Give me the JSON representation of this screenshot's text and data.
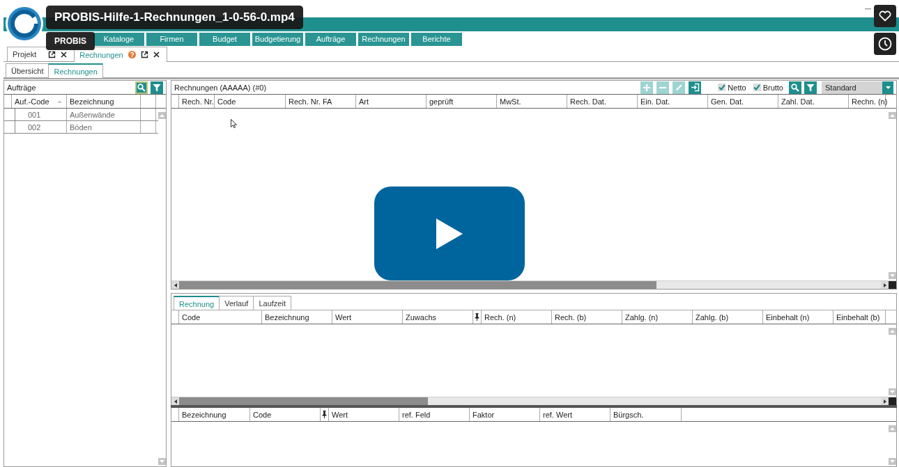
{
  "video": {
    "title": "PROBIS-Hilfe-1-Rechnungen_1-0-56-0.mp4",
    "channel": "PROBIS"
  },
  "app": {
    "nav": [
      "Kataloge",
      "Firmen",
      "Budget",
      "Budgetierung",
      "Aufträge",
      "Rechnungen",
      "Berichte"
    ],
    "doc_tabs": [
      {
        "label": "Projekt",
        "selected": false,
        "help": false
      },
      {
        "label": "Rechnungen",
        "selected": true,
        "help": true
      }
    ],
    "sub_tabs": [
      {
        "label": "Übersicht",
        "selected": false
      },
      {
        "label": "Rechnungen",
        "selected": true
      }
    ],
    "orders": {
      "title": "Aufträge",
      "columns": [
        {
          "label": "Auf.-Code",
          "kind": "text",
          "sorted": true
        },
        {
          "label": "Bezeichnung",
          "kind": "text",
          "sorted": false
        }
      ],
      "rows": [
        [
          "001",
          "Außenwände"
        ],
        [
          "002",
          "Böden"
        ]
      ]
    },
    "invoices": {
      "title": "Rechnungen (AAAAA) (#0)",
      "toolbar": [
        {
          "kind": "add",
          "disabled": true
        },
        {
          "kind": "remove",
          "disabled": true
        },
        {
          "kind": "edit",
          "disabled": true
        },
        {
          "kind": "import",
          "disabled": false
        }
      ],
      "checkboxes": [
        {
          "label": "Netto",
          "checked": true
        },
        {
          "label": "Brutto",
          "checked": true
        }
      ],
      "view": "Standard",
      "columns": [
        {
          "label": "Rech. Nr.",
          "kind": "text"
        },
        {
          "label": "Code",
          "kind": "text"
        },
        {
          "label": "Rech. Nr. FA",
          "kind": "text"
        },
        {
          "label": "Art",
          "kind": "text"
        },
        {
          "label": "geprüft",
          "kind": "text"
        },
        {
          "label": "MwSt.",
          "kind": "text"
        },
        {
          "label": "Rech. Dat.",
          "kind": "text"
        },
        {
          "label": "Ein. Dat.",
          "kind": "text"
        },
        {
          "label": "Gen. Dat.",
          "kind": "text"
        },
        {
          "label": "Zahl. Dat.",
          "kind": "text"
        },
        {
          "label": "Rechn. (n)",
          "kind": "text"
        }
      ]
    },
    "detail_tabs": [
      {
        "label": "Rechnung",
        "selected": true
      },
      {
        "label": "Verlauf",
        "selected": false
      },
      {
        "label": "Laufzeit",
        "selected": false
      }
    ],
    "detail_columns": [
      {
        "label": "Code",
        "kind": "text"
      },
      {
        "label": "Bezeichnung",
        "kind": "text"
      },
      {
        "label": "Wert",
        "kind": "text"
      },
      {
        "label": "Zuwachs",
        "kind": "text"
      },
      {
        "kind": "pin"
      },
      {
        "label": "Rech. (n)",
        "kind": "text"
      },
      {
        "label": "Rech. (b)",
        "kind": "text"
      },
      {
        "label": "Zahlg. (n)",
        "kind": "text"
      },
      {
        "label": "Zahlg. (b)",
        "kind": "text"
      },
      {
        "label": "Einbehalt (n)",
        "kind": "text"
      },
      {
        "label": "Einbehalt (b)",
        "kind": "text"
      }
    ],
    "guarantee_columns": [
      {
        "label": "Bezeichnung",
        "kind": "text"
      },
      {
        "label": "Code",
        "kind": "text"
      },
      {
        "kind": "pin"
      },
      {
        "label": "Wert",
        "kind": "text"
      },
      {
        "label": "ref. Feld",
        "kind": "text"
      },
      {
        "label": "Faktor",
        "kind": "text"
      },
      {
        "label": "ref. Wert",
        "kind": "text"
      },
      {
        "label": "Bürgsch.",
        "kind": "text"
      }
    ]
  }
}
